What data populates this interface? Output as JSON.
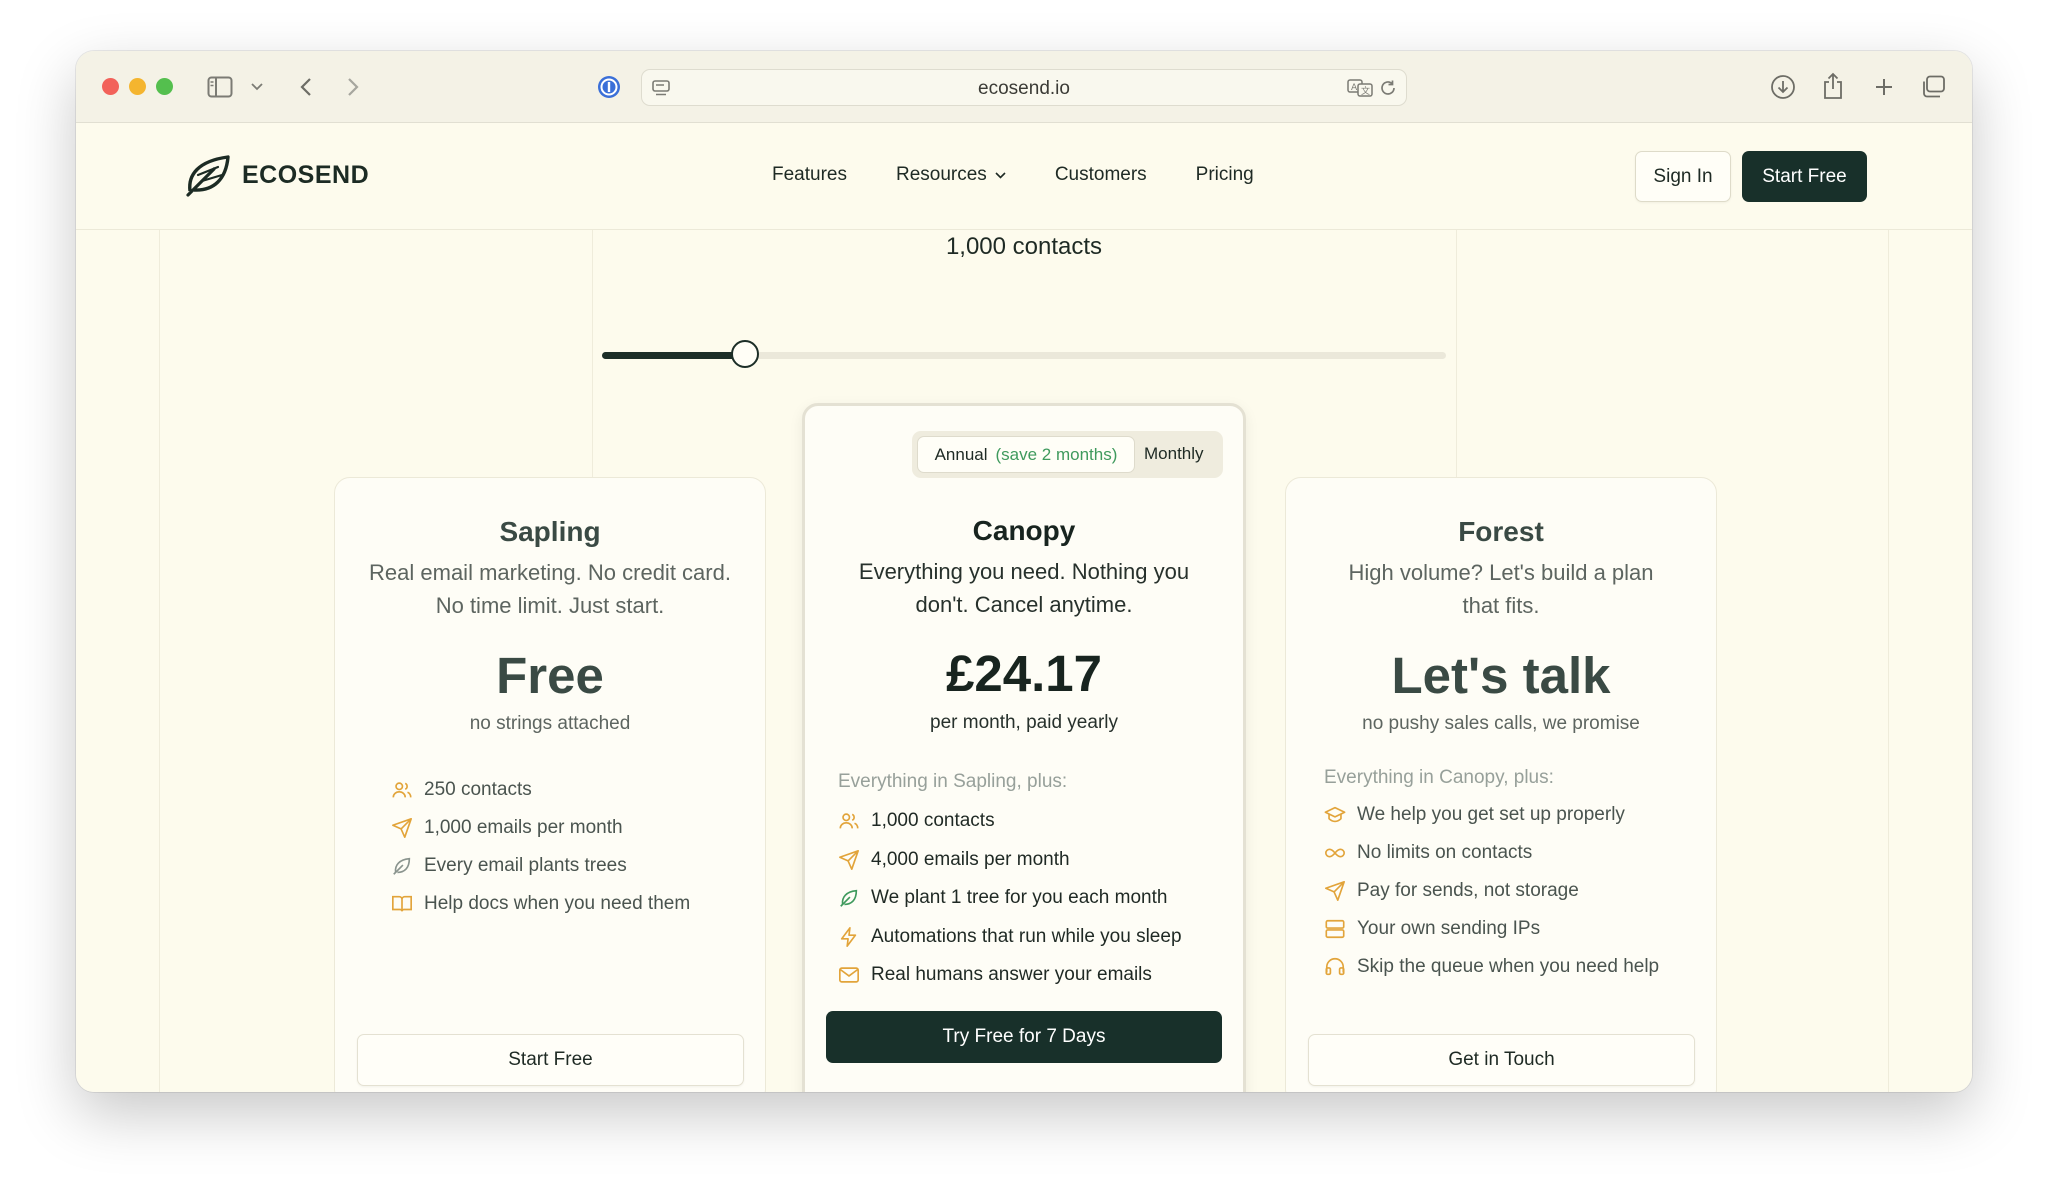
{
  "browser": {
    "url": "ecosend.io"
  },
  "nav": {
    "brand": "ECOSEND",
    "links": [
      "Features",
      "Resources",
      "Customers",
      "Pricing"
    ],
    "sign_in": "Sign In",
    "start_free": "Start Free"
  },
  "slider": {
    "label": "1,000 contacts",
    "fill_fraction": 0.17
  },
  "billing_toggle": {
    "annual": "Annual",
    "annual_note": "(save 2 months)",
    "monthly": "Monthly",
    "selected": "Annual"
  },
  "plans": [
    {
      "name": "Sapling",
      "description": "Real email marketing. No credit card. No time limit. Just start.",
      "price": "Free",
      "price_note": "no strings attached",
      "features_intro": "",
      "features": [
        {
          "icon": "users-icon",
          "text": "250 contacts"
        },
        {
          "icon": "send-icon",
          "text": "1,000 emails per month"
        },
        {
          "icon": "leaf-icon",
          "text": "Every email plants trees"
        },
        {
          "icon": "book-icon",
          "text": "Help docs when you need them"
        }
      ],
      "cta": "Start Free"
    },
    {
      "name": "Canopy",
      "description": "Everything you need. Nothing you don't. Cancel anytime.",
      "price": "£24.17",
      "price_note": "per month, paid yearly",
      "features_intro": "Everything in Sapling, plus:",
      "features": [
        {
          "icon": "users-icon",
          "text": "1,000 contacts"
        },
        {
          "icon": "send-icon",
          "text": "4,000 emails per month"
        },
        {
          "icon": "leaf-icon",
          "text": "We plant 1 tree for you each month"
        },
        {
          "icon": "bolt-icon",
          "text": "Automations that run while you sleep"
        },
        {
          "icon": "mail-icon",
          "text": "Real humans answer your emails"
        }
      ],
      "cta": "Try Free for 7 Days"
    },
    {
      "name": "Forest",
      "description": "High volume? Let's build a plan that fits.",
      "price": "Let's talk",
      "price_note": "no pushy sales calls, we promise",
      "features_intro": "Everything in Canopy, plus:",
      "features": [
        {
          "icon": "graduation-cap-icon",
          "text": "We help you get set up properly"
        },
        {
          "icon": "infinity-icon",
          "text": "No limits on contacts"
        },
        {
          "icon": "send-icon",
          "text": "Pay for sends, not storage"
        },
        {
          "icon": "server-icon",
          "text": "Your own sending IPs"
        },
        {
          "icon": "headset-icon",
          "text": "Skip the queue when you need help"
        }
      ],
      "cta": "Get in Touch"
    }
  ],
  "colors": {
    "page_bg": "#fdfbed",
    "primary": "#18302a",
    "accent_icon": "#e2a43a",
    "save_green": "#3f9a5d"
  }
}
